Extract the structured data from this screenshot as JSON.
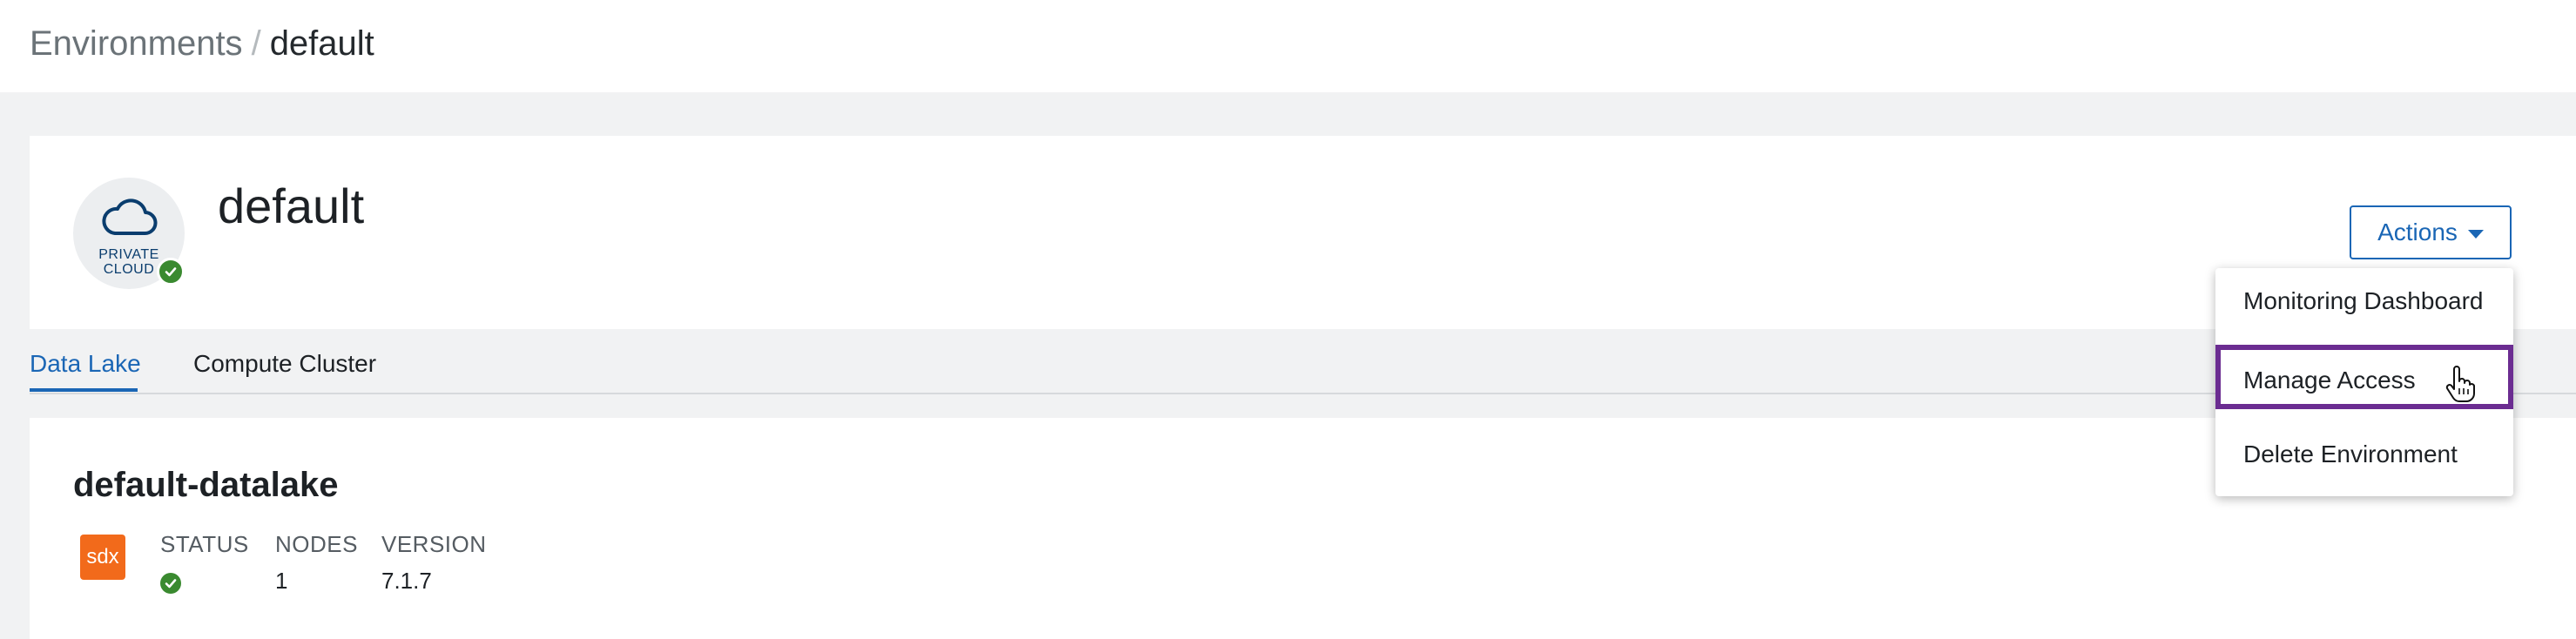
{
  "breadcrumb": {
    "parent": "Environments",
    "separator": "/",
    "current": "default"
  },
  "environment": {
    "icon_name": "cloud-icon",
    "icon_label_line1": "PRIVATE",
    "icon_label_line2": "CLOUD",
    "status_icon": "check-circle-icon",
    "name": "default"
  },
  "actions": {
    "button_label": "Actions",
    "menu": [
      {
        "label": "Monitoring Dashboard"
      },
      {
        "label": "Manage Access",
        "highlighted": true
      },
      {
        "label": "Delete Environment"
      }
    ]
  },
  "tabs": [
    {
      "label": "Data Lake",
      "active": true
    },
    {
      "label": "Compute Cluster",
      "active": false
    }
  ],
  "datalake": {
    "name": "default-datalake",
    "logo_text": "sdx",
    "columns": {
      "status_label": "STATUS",
      "nodes_label": "NODES",
      "version_label": "VERSION"
    },
    "values": {
      "status_icon": "check-circle-icon",
      "nodes": "1",
      "version": "7.1.7"
    }
  },
  "colors": {
    "accent": "#1a66b5",
    "success": "#3a8a30",
    "sdx_orange": "#f26a1b",
    "highlight_purple": "#6b2c91"
  },
  "cursor": "hand-pointer-icon"
}
